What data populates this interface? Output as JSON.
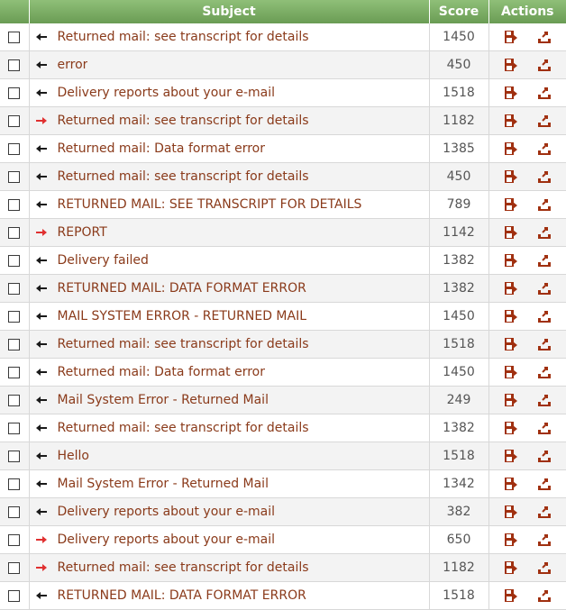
{
  "header": {
    "check": "",
    "subject": "Subject",
    "score": "Score",
    "actions": "Actions"
  },
  "colors": {
    "header_green": "#7aae63",
    "subject_text": "#8a3a1a",
    "incoming_arrow": "#1a1a1a",
    "outgoing_arrow": "#e03030",
    "action_icon": "#a03010"
  },
  "icons": {
    "incoming": "arrow-left-icon",
    "outgoing": "arrow-right-icon",
    "save": "save-disk-icon",
    "export": "export-icon"
  },
  "rows": [
    {
      "direction": "in",
      "subject": "Returned mail: see transcript for details",
      "score": "1450"
    },
    {
      "direction": "in",
      "subject": "error",
      "score": "450"
    },
    {
      "direction": "in",
      "subject": "Delivery reports about your e-mail",
      "score": "1518"
    },
    {
      "direction": "out",
      "subject": "Returned mail: see transcript for details",
      "score": "1182"
    },
    {
      "direction": "in",
      "subject": "Returned mail: Data format error",
      "score": "1385"
    },
    {
      "direction": "in",
      "subject": "Returned mail: see transcript for details",
      "score": "450"
    },
    {
      "direction": "in",
      "subject": "RETURNED MAIL: SEE TRANSCRIPT FOR DETAILS",
      "score": "789"
    },
    {
      "direction": "out",
      "subject": "REPORT",
      "score": "1142"
    },
    {
      "direction": "in",
      "subject": "Delivery failed",
      "score": "1382"
    },
    {
      "direction": "in",
      "subject": "RETURNED MAIL: DATA FORMAT ERROR",
      "score": "1382"
    },
    {
      "direction": "in",
      "subject": "MAIL SYSTEM ERROR - RETURNED MAIL",
      "score": "1450"
    },
    {
      "direction": "in",
      "subject": "Returned mail: see transcript for details",
      "score": "1518"
    },
    {
      "direction": "in",
      "subject": "Returned mail: Data format error",
      "score": "1450"
    },
    {
      "direction": "in",
      "subject": "Mail System Error - Returned Mail",
      "score": "249"
    },
    {
      "direction": "in",
      "subject": "Returned mail: see transcript for details",
      "score": "1382"
    },
    {
      "direction": "in",
      "subject": "Hello",
      "score": "1518"
    },
    {
      "direction": "in",
      "subject": "Mail System Error - Returned Mail",
      "score": "1342"
    },
    {
      "direction": "in",
      "subject": "Delivery reports about your e-mail",
      "score": "382"
    },
    {
      "direction": "out",
      "subject": "Delivery reports about your e-mail",
      "score": "650"
    },
    {
      "direction": "out",
      "subject": "Returned mail: see transcript for details",
      "score": "1182"
    },
    {
      "direction": "in",
      "subject": "RETURNED MAIL: DATA FORMAT ERROR",
      "score": "1518"
    }
  ]
}
